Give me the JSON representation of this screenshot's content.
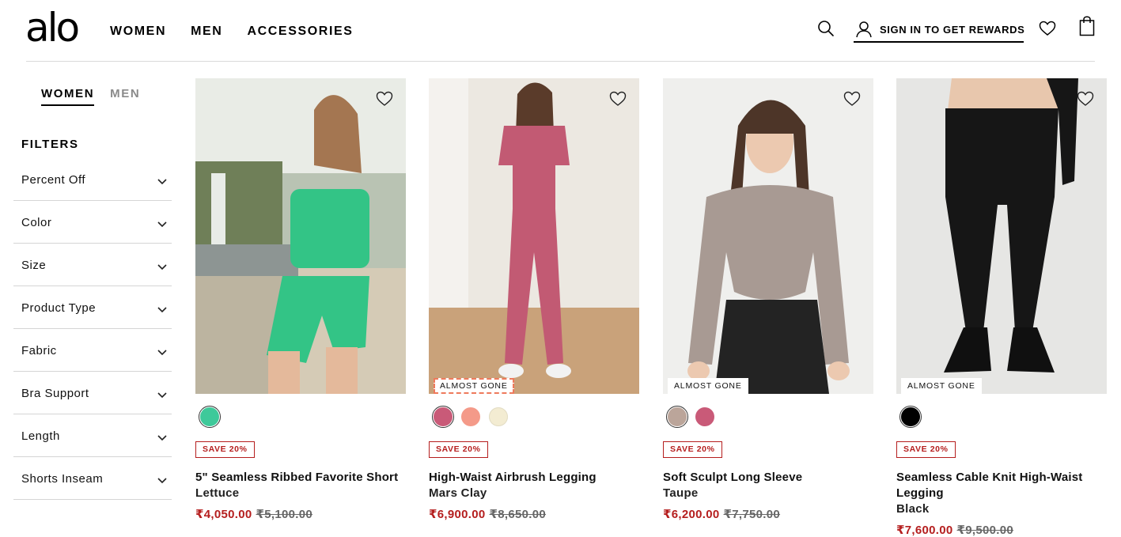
{
  "header": {
    "logo": "alo",
    "nav": [
      "WOMEN",
      "MEN",
      "ACCESSORIES"
    ],
    "signin_label": "SIGN IN TO GET REWARDS"
  },
  "sidebar": {
    "gender_tabs": [
      "WOMEN",
      "MEN"
    ],
    "filters_title": "FILTERS",
    "filters": [
      "Percent Off",
      "Color",
      "Size",
      "Product Type",
      "Fabric",
      "Bra Support",
      "Length",
      "Shorts Inseam"
    ]
  },
  "products": [
    {
      "name": "5\" Seamless Ribbed Favorite Short",
      "color": "Lettuce",
      "price": "₹4,050.00",
      "original_price": "₹5,100.00",
      "save_badge": "SAVE 20%",
      "stock_badge": "",
      "swatches": [
        "#3ec99a"
      ],
      "image_bg": "#c7cfc2",
      "garment": "#33c486"
    },
    {
      "name": "High-Waist Airbrush Legging",
      "color": "Mars Clay",
      "price": "₹6,900.00",
      "original_price": "₹8,650.00",
      "save_badge": "SAVE 20%",
      "stock_badge": "ALMOST GONE",
      "swatches": [
        "#c95a78",
        "#f49a89",
        "#f3ecd2"
      ],
      "image_bg": "#ede9e3",
      "garment": "#c25a73"
    },
    {
      "name": "Soft Sculpt Long Sleeve",
      "color": "Taupe",
      "price": "₹6,200.00",
      "original_price": "₹7,750.00",
      "save_badge": "SAVE 20%",
      "stock_badge": "ALMOST GONE",
      "swatches": [
        "#bba59a",
        "#c95a78"
      ],
      "image_bg": "#efefed",
      "garment": "#a89a93"
    },
    {
      "name": "Seamless Cable Knit High-Waist Legging",
      "color": "Black",
      "price": "₹7,600.00",
      "original_price": "₹9,500.00",
      "save_badge": "SAVE 20%",
      "stock_badge": "ALMOST GONE",
      "swatches": [
        "#000000"
      ],
      "image_bg": "#e6e6e4",
      "garment": "#161616"
    }
  ]
}
